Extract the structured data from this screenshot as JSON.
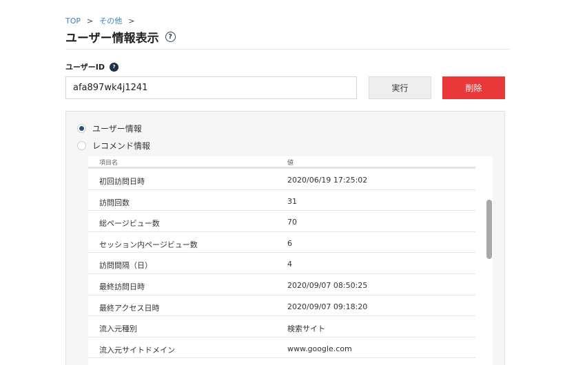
{
  "breadcrumb": {
    "items": [
      "TOP",
      "その他"
    ],
    "separator": ">"
  },
  "page": {
    "title": "ユーザー情報表示",
    "help_glyph": "?"
  },
  "form": {
    "label": "ユーザーID",
    "info_glyph": "?",
    "user_id_value": "afa897wk4j1241",
    "run_label": "実行",
    "delete_label": "削除"
  },
  "colors": {
    "link": "#3b82c4",
    "delete_button": "#e8383a",
    "radio_checked": "#2b4f7e"
  },
  "radios": [
    {
      "label": "ユーザー情報",
      "checked": true
    },
    {
      "label": "レコメンド情報",
      "checked": false
    }
  ],
  "table": {
    "headers": [
      "項目名",
      "値"
    ],
    "rows": [
      {
        "key": "初回訪問日時",
        "value": "2020/06/19 17:25:02"
      },
      {
        "key": "訪問回数",
        "value": "31"
      },
      {
        "key": "総ページビュー数",
        "value": "70"
      },
      {
        "key": "セッション内ページビュー数",
        "value": "6"
      },
      {
        "key": "訪問間隔（日）",
        "value": "4"
      },
      {
        "key": "最終訪問日時",
        "value": "2020/09/07 08:50:25"
      },
      {
        "key": "最終アクセス日時",
        "value": "2020/09/07 09:18:20"
      },
      {
        "key": "流入元種別",
        "value": "検索サイト"
      },
      {
        "key": "流入元サイトドメイン",
        "value": "www.google.com"
      },
      {
        "key": "",
        "value": ""
      }
    ]
  }
}
